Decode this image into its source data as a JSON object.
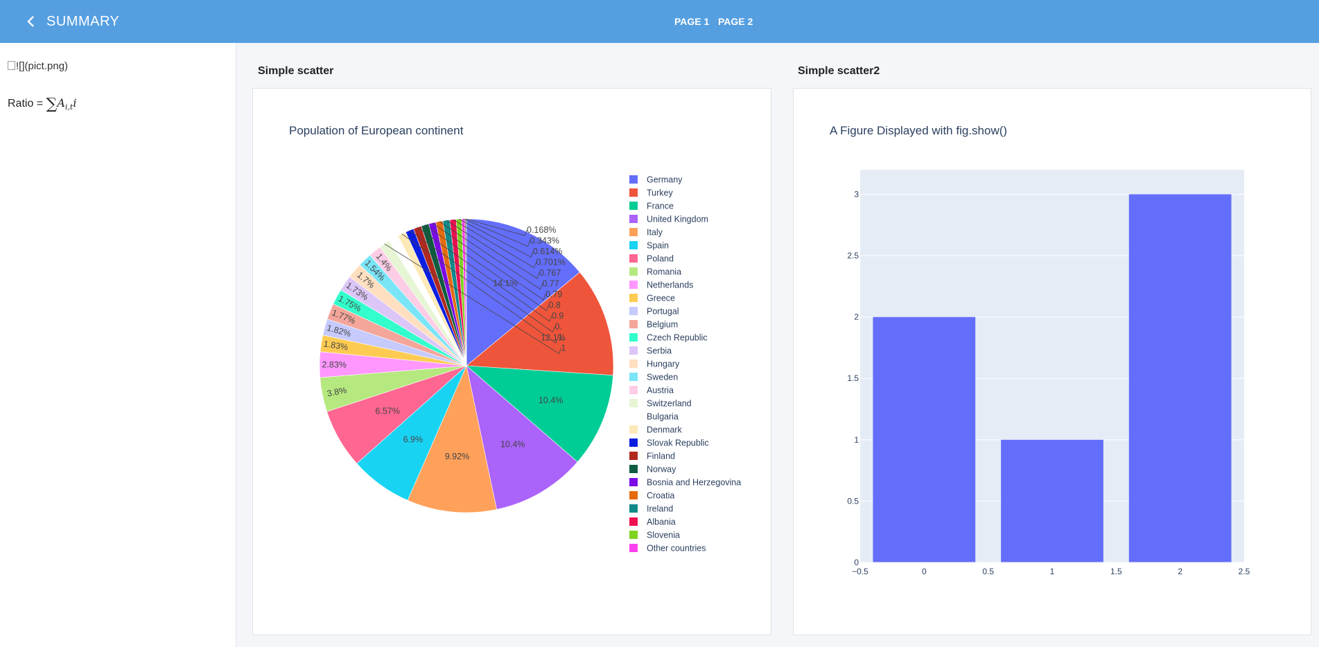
{
  "header": {
    "title": "SUMMARY",
    "back_icon": "chevron-left-icon",
    "pages": [
      "PAGE 1",
      "PAGE 2"
    ]
  },
  "sidebar": {
    "image_alt": "![](pict.png)",
    "formula_label": "Ratio =",
    "formula_sigma": "∑",
    "formula_var": "A",
    "formula_sub": "i,t",
    "formula_tail": "i"
  },
  "panels": [
    {
      "title": "Simple scatter"
    },
    {
      "title": "Simple scatter2"
    }
  ],
  "chart_data": [
    {
      "type": "pie",
      "title": "Population of European continent",
      "slices": [
        {
          "label": "Germany",
          "value": 14.1,
          "color": "#636efa",
          "text": "14.1%"
        },
        {
          "label": "Turkey",
          "value": 12.1,
          "color": "#ef553b",
          "text": "12.1%"
        },
        {
          "label": "France",
          "value": 10.4,
          "color": "#00cc96",
          "text": "10.4%"
        },
        {
          "label": "United Kingdom",
          "value": 10.4,
          "color": "#ab63fa",
          "text": "10.4%"
        },
        {
          "label": "Italy",
          "value": 9.92,
          "color": "#ffa15a",
          "text": "9.92%"
        },
        {
          "label": "Spain",
          "value": 6.9,
          "color": "#19d3f3",
          "text": "6.9%"
        },
        {
          "label": "Poland",
          "value": 6.57,
          "color": "#ff6692",
          "text": "6.57%"
        },
        {
          "label": "Romania",
          "value": 3.8,
          "color": "#b6e880",
          "text": "3.8%"
        },
        {
          "label": "Netherlands",
          "value": 2.83,
          "color": "#ff97ff",
          "text": "2.83%"
        },
        {
          "label": "Greece",
          "value": 1.83,
          "color": "#fecb52",
          "text": "1.83%"
        },
        {
          "label": "Portugal",
          "value": 1.82,
          "color": "#c6cafd",
          "text": "1.82%"
        },
        {
          "label": "Belgium",
          "value": 1.77,
          "color": "#f4a69a",
          "text": "1.77%"
        },
        {
          "label": "Czech Republic",
          "value": 1.75,
          "color": "#33ffcc",
          "text": "1.75%"
        },
        {
          "label": "Serbia",
          "value": 1.73,
          "color": "#dcc6f7",
          "text": "1.73%"
        },
        {
          "label": "Hungary",
          "value": 1.7,
          "color": "#ffdfc0",
          "text": "1.7%"
        },
        {
          "label": "Sweden",
          "value": 1.54,
          "color": "#7ae5f6",
          "text": "1.54%"
        },
        {
          "label": "Austria",
          "value": 1.4,
          "color": "#fccde5",
          "text": "1.4%"
        },
        {
          "label": "Switzerland",
          "value": 1.2,
          "color": "#e6f5d4",
          "text": "1"
        },
        {
          "label": "Bulgaria",
          "value": 1.1,
          "color": "#ffffff",
          "text": ""
        },
        {
          "label": "Denmark",
          "value": 0.95,
          "color": "#fde9b8",
          "text": "1."
        },
        {
          "label": "Slovak Republic",
          "value": 0.92,
          "color": "#0b1ee0",
          "text": "0."
        },
        {
          "label": "Finland",
          "value": 0.9,
          "color": "#b0291e",
          "text": "0.9"
        },
        {
          "label": "Norway",
          "value": 0.85,
          "color": "#0e5c40",
          "text": "0.8"
        },
        {
          "label": "Bosnia and Herzegovina",
          "value": 0.79,
          "color": "#7b0ae6",
          "text": "0.79"
        },
        {
          "label": "Croatia",
          "value": 0.777,
          "color": "#e56a0e",
          "text": "0.77"
        },
        {
          "label": "Ireland",
          "value": 0.767,
          "color": "#118a8a",
          "text": "0.767"
        },
        {
          "label": "Albania",
          "value": 0.701,
          "color": "#ef0e4f",
          "text": "0.701%"
        },
        {
          "label": "Slovenia",
          "value": 0.614,
          "color": "#7ed321",
          "text": "0.614%"
        },
        {
          "label": "Other countries",
          "value": 0.343,
          "color": "#ff40ee",
          "text": "0.343%"
        },
        {
          "label": "",
          "value": 0.168,
          "color": "#8c8c8c",
          "text": "0.168%"
        }
      ]
    },
    {
      "type": "bar",
      "title": "A Figure Displayed with fig.show()",
      "x": [
        0,
        1,
        2
      ],
      "values": [
        2,
        1,
        3
      ],
      "color": "#636efa",
      "xlim": [
        -0.5,
        2.5
      ],
      "ylim": [
        0,
        3.2
      ],
      "xticks": [
        -0.5,
        0,
        0.5,
        1,
        1.5,
        2,
        2.5
      ],
      "xtick_labels": [
        "−0.5",
        "0",
        "0.5",
        "1",
        "1.5",
        "2",
        "2.5"
      ],
      "yticks": [
        0,
        0.5,
        1,
        1.5,
        2,
        2.5,
        3
      ],
      "ytick_labels": [
        "0",
        "0.5",
        "1",
        "1.5",
        "2",
        "2.5",
        "3"
      ],
      "grid": true,
      "plot_background": "#e5ecf6"
    }
  ]
}
